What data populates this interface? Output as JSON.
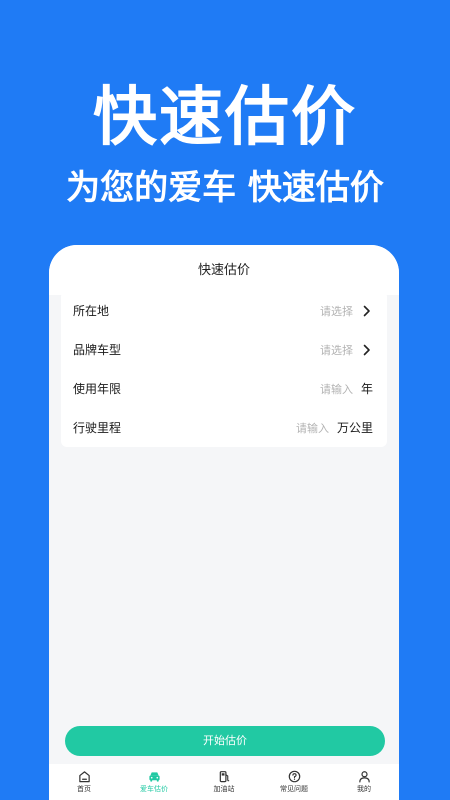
{
  "hero": {
    "title": "快速估价",
    "subtitle": "为您的爱车 快速估价"
  },
  "screen": {
    "header_title": "快速估价",
    "form": {
      "rows": [
        {
          "label": "所在地",
          "placeholder": "请选择",
          "suffix_icon": "chevron-right-icon"
        },
        {
          "label": "品牌车型",
          "placeholder": "请选择",
          "suffix_icon": "chevron-right-icon"
        },
        {
          "label": "使用年限",
          "placeholder": "请输入",
          "unit": "年"
        },
        {
          "label": "行驶里程",
          "placeholder": "请输入",
          "unit": "万公里"
        }
      ]
    },
    "start_button_label": "开始估价",
    "tabbar": {
      "items": [
        {
          "label": "首页",
          "icon": "home-icon",
          "active": false
        },
        {
          "label": "爱车估价",
          "icon": "car-icon",
          "active": true
        },
        {
          "label": "加油站",
          "icon": "fuel-pump-icon",
          "active": false
        },
        {
          "label": "常见问题",
          "icon": "question-circle-icon",
          "active": false
        },
        {
          "label": "我的",
          "icon": "user-icon",
          "active": false
        }
      ]
    }
  },
  "colors": {
    "background": "#1f7bf5",
    "accent": "#21c9a3",
    "card": "#ffffff",
    "screen_bg": "#f5f6f8"
  }
}
